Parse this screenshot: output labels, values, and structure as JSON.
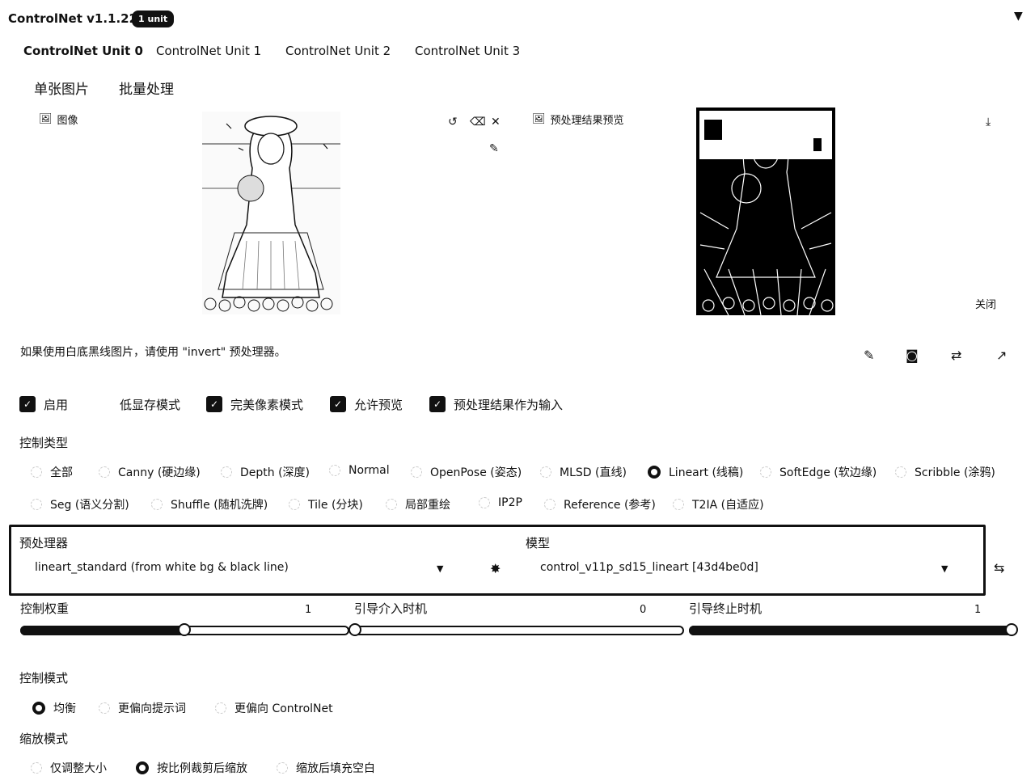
{
  "header": {
    "title": "ControlNet v1.1.224",
    "badge": "1 unit",
    "collapse_icon": "▼"
  },
  "tabs": [
    {
      "label": "ControlNet Unit 0"
    },
    {
      "label": "ControlNet Unit 1"
    },
    {
      "label": "ControlNet Unit 2"
    },
    {
      "label": "ControlNet Unit 3"
    }
  ],
  "subtabs": [
    {
      "label": "单张图片"
    },
    {
      "label": "批量处理"
    }
  ],
  "image_panel": {
    "label": "图像",
    "tools": [
      "undo-icon",
      "eraser-icon",
      "close-icon",
      "brush-icon"
    ]
  },
  "preview_panel": {
    "label": "预处理结果预览",
    "close_label": "关闭"
  },
  "hint": "如果使用白底黑线图片，请使用 \"invert\" 预处理器。",
  "checkboxes": [
    {
      "label": "启用",
      "checked": true
    },
    {
      "label": "低显存模式",
      "checked": false
    },
    {
      "label": "完美像素模式",
      "checked": true
    },
    {
      "label": "允许预览",
      "checked": true
    },
    {
      "label": "预处理结果作为输入",
      "checked": true
    }
  ],
  "control_type": {
    "label": "控制类型",
    "row1": [
      "全部",
      "Canny (硬边缘)",
      "Depth (深度)",
      "Normal",
      "OpenPose (姿态)",
      "MLSD (直线)",
      "Lineart (线稿)",
      "SoftEdge (软边缘)",
      "Scribble (涂鸦)"
    ],
    "row2": [
      "Seg (语义分割)",
      "Shuffle (随机洗牌)",
      "Tile (分块)",
      "局部重绘",
      "IP2P",
      "Reference (参考)",
      "T2IA (自适应)"
    ],
    "selected": "Lineart (线稿)"
  },
  "preprocessor": {
    "label": "预处理器",
    "value": "lineart_standard (from white bg & black line)"
  },
  "model": {
    "label": "模型",
    "value": "control_v11p_sd15_lineart [43d4be0d]"
  },
  "sliders": [
    {
      "label": "控制权重",
      "value": "1",
      "fraction": 0.5
    },
    {
      "label": "引导介入时机",
      "value": "0",
      "fraction": 0.0
    },
    {
      "label": "引导终止时机",
      "value": "1",
      "fraction": 1.0
    }
  ],
  "control_mode": {
    "label": "控制模式",
    "options": [
      "均衡",
      "更偏向提示词",
      "更偏向 ControlNet"
    ],
    "selected": "均衡"
  },
  "resize_mode": {
    "label": "缩放模式",
    "options": [
      "仅调整大小",
      "按比例裁剪后缩放",
      "缩放后填充空白"
    ],
    "selected": "按比例裁剪后缩放"
  }
}
